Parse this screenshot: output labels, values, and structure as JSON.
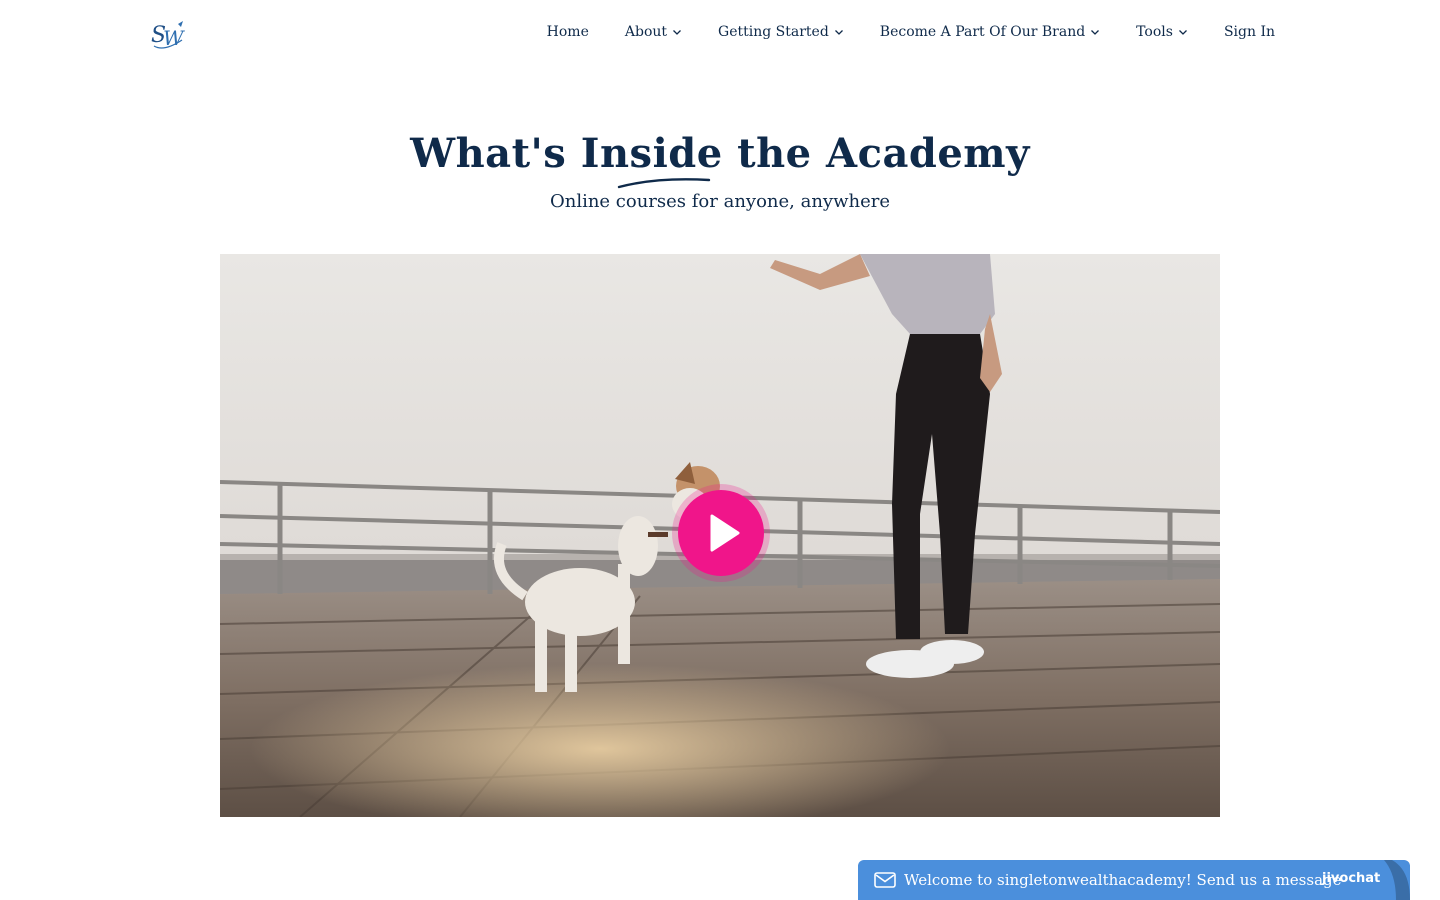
{
  "brand": {
    "logo_text": "SW",
    "logo_icon": "sw-monogram-logo"
  },
  "nav": {
    "items": [
      {
        "label": "Home",
        "has_dropdown": false
      },
      {
        "label": "About",
        "has_dropdown": true
      },
      {
        "label": "Getting Started",
        "has_dropdown": true
      },
      {
        "label": "Become A Part Of Our Brand",
        "has_dropdown": true
      },
      {
        "label": "Tools",
        "has_dropdown": true
      },
      {
        "label": "Sign In",
        "has_dropdown": false
      }
    ]
  },
  "hero": {
    "title_part1": "What's ",
    "title_highlight": "Inside",
    "title_part2": " the Academy",
    "subtitle": "Online courses for anyone, anywhere"
  },
  "video": {
    "play_icon": "play-icon"
  },
  "chat": {
    "message": "Welcome to singletonwealthacademy! Send us a message",
    "brand": "jivochat",
    "icon": "mail-icon"
  },
  "colors": {
    "navy": "#0f2a4a",
    "accent_pink": "#f0158a",
    "chat_blue": "#4b8fdc",
    "logo_blue": "#2f6fb0"
  }
}
